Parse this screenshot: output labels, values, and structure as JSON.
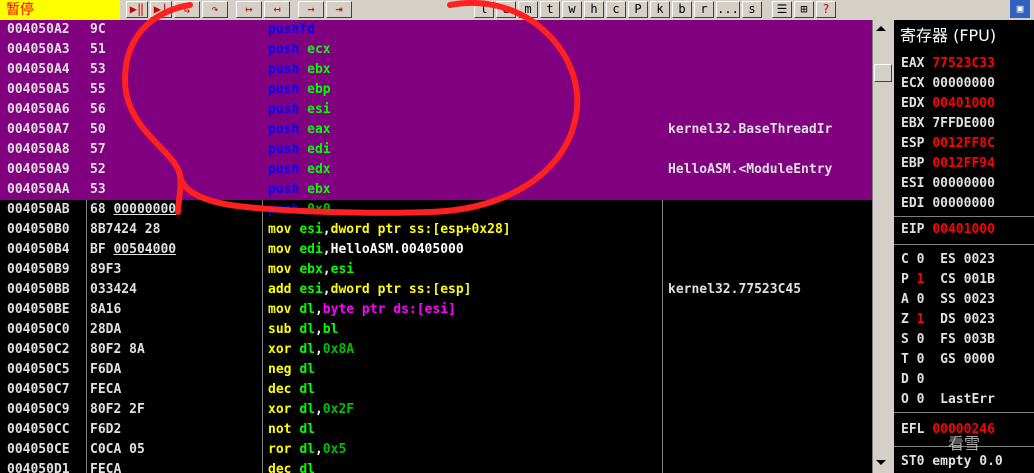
{
  "status_label": "暂停",
  "toolbar": {
    "buttons": [
      {
        "label": "▶‖",
        "name": "run-button"
      },
      {
        "label": "▶|",
        "name": "pause-button"
      },
      {
        "label": "↳",
        "name": "step-into-button"
      },
      {
        "label": "↷",
        "name": "step-over-button"
      },
      {
        "label": "↦",
        "name": "trace-into-button"
      },
      {
        "label": "↤",
        "name": "trace-over-button"
      },
      {
        "label": "→",
        "name": "execute-till-return-button"
      },
      {
        "label": "⇥",
        "name": "goto-button"
      }
    ],
    "letters": [
      "l",
      "e",
      "m",
      "t",
      "w",
      "h",
      "c",
      "P",
      "k",
      "b",
      "r",
      "...",
      "s"
    ],
    "misc": [
      "☰",
      "⊞",
      "?"
    ]
  },
  "registers_title": "寄存器 (FPU)",
  "disasm": [
    {
      "addr": "004050A2",
      "hex": "9C",
      "mn": "pushfd",
      "ops": [],
      "cmt": "",
      "sel": true,
      "blue": true
    },
    {
      "addr": "004050A3",
      "hex": "51",
      "mn": "push",
      "ops": [
        {
          "t": "ecx",
          "k": "reg"
        }
      ],
      "cmt": "",
      "sel": true,
      "blue": true
    },
    {
      "addr": "004050A4",
      "hex": "53",
      "mn": "push",
      "ops": [
        {
          "t": "ebx",
          "k": "reg"
        }
      ],
      "cmt": "",
      "sel": true,
      "blue": true
    },
    {
      "addr": "004050A5",
      "hex": "55",
      "mn": "push",
      "ops": [
        {
          "t": "ebp",
          "k": "reg"
        }
      ],
      "cmt": "",
      "sel": true,
      "blue": true
    },
    {
      "addr": "004050A6",
      "hex": "56",
      "mn": "push",
      "ops": [
        {
          "t": "esi",
          "k": "reg"
        }
      ],
      "cmt": "",
      "sel": true,
      "blue": true
    },
    {
      "addr": "004050A7",
      "hex": "50",
      "mn": "push",
      "ops": [
        {
          "t": "eax",
          "k": "reg"
        }
      ],
      "cmt": "kernel32.BaseThreadIr",
      "sel": true,
      "blue": true
    },
    {
      "addr": "004050A8",
      "hex": "57",
      "mn": "push",
      "ops": [
        {
          "t": "edi",
          "k": "reg"
        }
      ],
      "cmt": "",
      "sel": true,
      "blue": true
    },
    {
      "addr": "004050A9",
      "hex": "52",
      "mn": "push",
      "ops": [
        {
          "t": "edx",
          "k": "reg"
        }
      ],
      "cmt": "HelloASM.<ModuleEntry",
      "sel": true,
      "blue": true
    },
    {
      "addr": "004050AA",
      "hex": "53",
      "mn": "push",
      "ops": [
        {
          "t": "ebx",
          "k": "reg"
        }
      ],
      "cmt": "",
      "sel": true,
      "blue": true
    },
    {
      "addr": "004050AB",
      "hex": "68 00000000",
      "hexu": "00000000",
      "mn": "push",
      "ops": [
        {
          "t": "0x0",
          "k": "num"
        }
      ],
      "cmt": "",
      "sel": false,
      "blue": true
    },
    {
      "addr": "004050B0",
      "hex": "8B7424 28",
      "mn": "mov",
      "ops": [
        {
          "t": "esi",
          "k": "reg"
        },
        {
          "t": ",",
          "k": "p"
        },
        {
          "t": "dword ptr ss:[esp+0x28]",
          "k": "mem2"
        }
      ],
      "cmt": "",
      "sel": false
    },
    {
      "addr": "004050B4",
      "hex": "BF 00504000",
      "hexu": "00504000",
      "mn": "mov",
      "ops": [
        {
          "t": "edi",
          "k": "reg"
        },
        {
          "t": ",",
          "k": "p"
        },
        {
          "t": "HelloASM.00405000",
          "k": "p"
        }
      ],
      "cmt": "",
      "sel": false
    },
    {
      "addr": "004050B9",
      "hex": "89F3",
      "mn": "mov",
      "ops": [
        {
          "t": "ebx",
          "k": "reg"
        },
        {
          "t": ",",
          "k": "p"
        },
        {
          "t": "esi",
          "k": "reg"
        }
      ],
      "cmt": "",
      "sel": false
    },
    {
      "addr": "004050BB",
      "hex": "033424",
      "mn": "add",
      "ops": [
        {
          "t": "esi",
          "k": "reg"
        },
        {
          "t": ",",
          "k": "p"
        },
        {
          "t": "dword ptr ss:[esp]",
          "k": "mem2"
        }
      ],
      "cmt": "kernel32.77523C45",
      "sel": false
    },
    {
      "addr": "004050BE",
      "hex": "8A16",
      "mn": "mov",
      "ops": [
        {
          "t": "dl",
          "k": "reg"
        },
        {
          "t": ",",
          "k": "p"
        },
        {
          "t": "byte ptr ds:[esi]",
          "k": "mem"
        }
      ],
      "cmt": "",
      "sel": false
    },
    {
      "addr": "004050C0",
      "hex": "28DA",
      "mn": "sub",
      "ops": [
        {
          "t": "dl",
          "k": "reg"
        },
        {
          "t": ",",
          "k": "p"
        },
        {
          "t": "bl",
          "k": "reg"
        }
      ],
      "cmt": "",
      "sel": false
    },
    {
      "addr": "004050C2",
      "hex": "80F2 8A",
      "mn": "xor",
      "ops": [
        {
          "t": "dl",
          "k": "reg"
        },
        {
          "t": ",",
          "k": "p"
        },
        {
          "t": "0x8A",
          "k": "num"
        }
      ],
      "cmt": "",
      "sel": false
    },
    {
      "addr": "004050C5",
      "hex": "F6DA",
      "mn": "neg",
      "ops": [
        {
          "t": "dl",
          "k": "reg"
        }
      ],
      "cmt": "",
      "sel": false
    },
    {
      "addr": "004050C7",
      "hex": "FECA",
      "mn": "dec",
      "ops": [
        {
          "t": "dl",
          "k": "reg"
        }
      ],
      "cmt": "",
      "sel": false
    },
    {
      "addr": "004050C9",
      "hex": "80F2 2F",
      "mn": "xor",
      "ops": [
        {
          "t": "dl",
          "k": "reg"
        },
        {
          "t": ",",
          "k": "p"
        },
        {
          "t": "0x2F",
          "k": "num"
        }
      ],
      "cmt": "",
      "sel": false
    },
    {
      "addr": "004050CC",
      "hex": "F6D2",
      "mn": "not",
      "ops": [
        {
          "t": "dl",
          "k": "reg"
        }
      ],
      "cmt": "",
      "sel": false
    },
    {
      "addr": "004050CE",
      "hex": "C0CA 05",
      "mn": "ror",
      "ops": [
        {
          "t": "dl",
          "k": "reg"
        },
        {
          "t": ",",
          "k": "p"
        },
        {
          "t": "0x5",
          "k": "num"
        }
      ],
      "cmt": "",
      "sel": false
    },
    {
      "addr": "004050D1",
      "hex": "FECA",
      "mn": "dec",
      "ops": [
        {
          "t": "dl",
          "k": "reg"
        }
      ],
      "cmt": "",
      "sel": false
    }
  ],
  "registers": [
    {
      "name": "EAX",
      "val": "77523C33",
      "chg": true
    },
    {
      "name": "ECX",
      "val": "00000000",
      "chg": false
    },
    {
      "name": "EDX",
      "val": "00401000",
      "chg": true
    },
    {
      "name": "EBX",
      "val": "7FFDE000",
      "chg": false
    },
    {
      "name": "ESP",
      "val": "0012FF8C",
      "chg": true
    },
    {
      "name": "EBP",
      "val": "0012FF94",
      "chg": true
    },
    {
      "name": "ESI",
      "val": "00000000",
      "chg": false
    },
    {
      "name": "EDI",
      "val": "00000000",
      "chg": false
    }
  ],
  "eip": {
    "name": "EIP",
    "val": "00401000",
    "chg": true
  },
  "flags": [
    {
      "f": "C",
      "v": "0",
      "chg": false,
      "seg": "ES",
      "segv": "0023"
    },
    {
      "f": "P",
      "v": "1",
      "chg": true,
      "seg": "CS",
      "segv": "001B"
    },
    {
      "f": "A",
      "v": "0",
      "chg": false,
      "seg": "SS",
      "segv": "0023"
    },
    {
      "f": "Z",
      "v": "1",
      "chg": true,
      "seg": "DS",
      "segv": "0023"
    },
    {
      "f": "S",
      "v": "0",
      "chg": false,
      "seg": "FS",
      "segv": "003B"
    },
    {
      "f": "T",
      "v": "0",
      "chg": false,
      "seg": "GS",
      "segv": "0000"
    },
    {
      "f": "D",
      "v": "0",
      "chg": false,
      "seg": "",
      "segv": ""
    },
    {
      "f": "O",
      "v": "0",
      "chg": false,
      "seg": "LastErr",
      "segv": ""
    }
  ],
  "efl": {
    "name": "EFL",
    "val": "00000246",
    "chg": true
  },
  "st0": "ST0 empty 0.0",
  "watermark": "看雪",
  "colors": {
    "selection": "#800080",
    "changed": "#ff0000",
    "register_op": "#00ff00",
    "mnemonic": "#ffff00",
    "stack_push": "#0000ff",
    "memory_op": "#ff00ff",
    "annotation": "#ff2020"
  }
}
